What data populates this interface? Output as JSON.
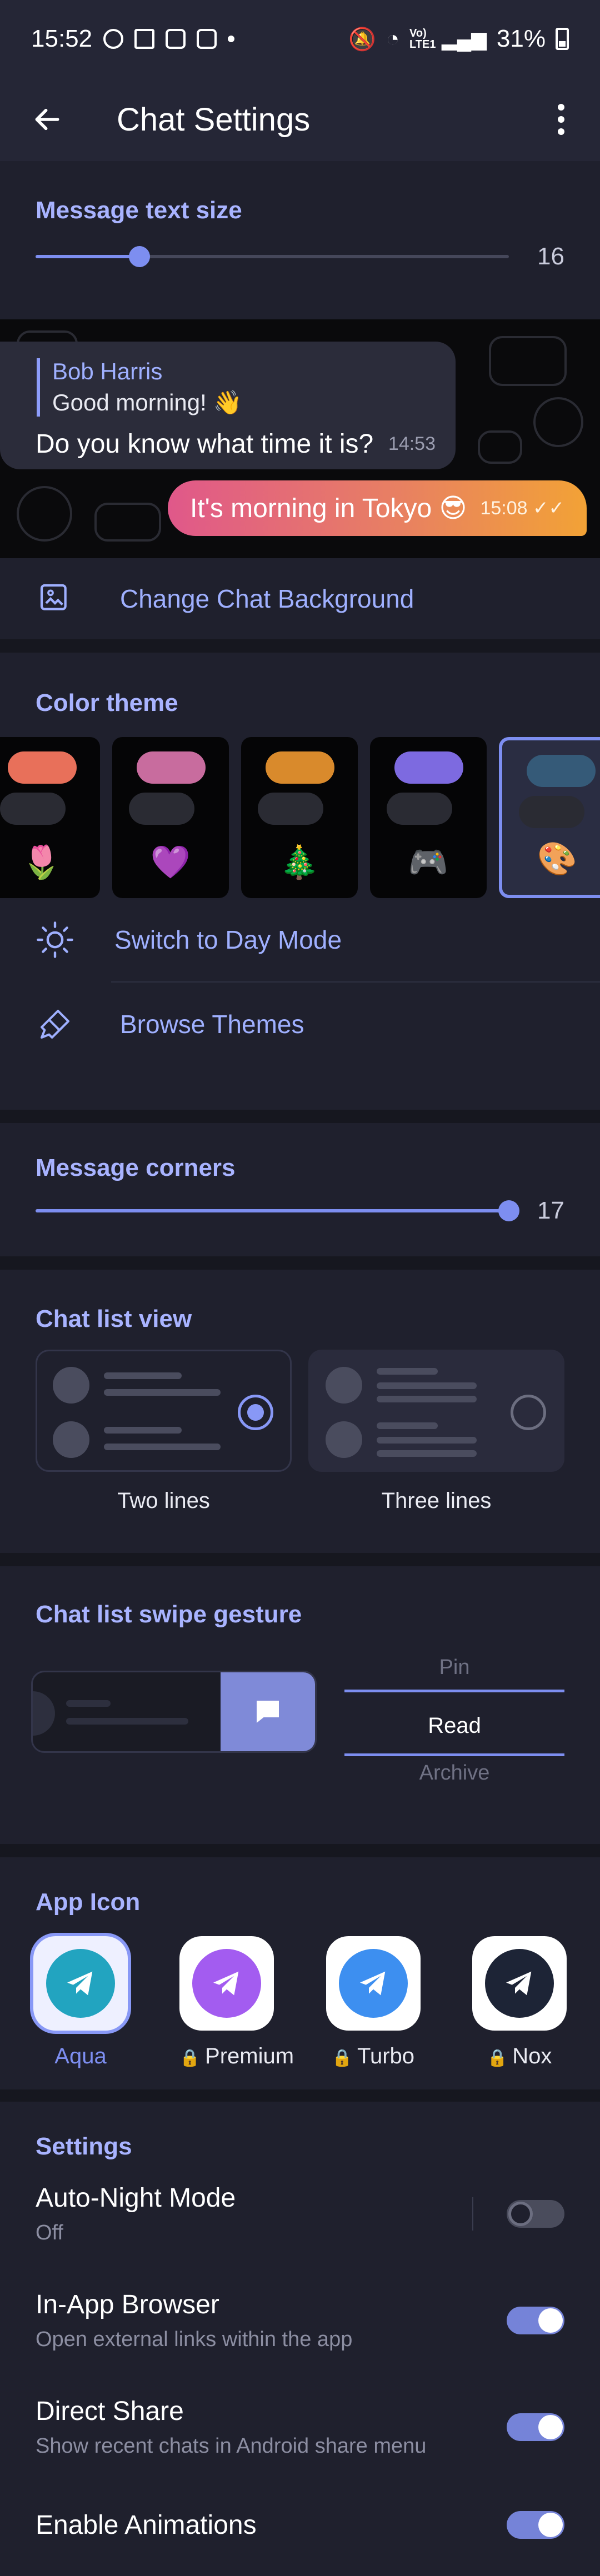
{
  "status_bar": {
    "time": "15:52",
    "battery": "31%",
    "signal_label": "Vo) LTE1"
  },
  "app_bar": {
    "title": "Chat Settings",
    "back_icon": "arrow-left",
    "menu_icon": "more-vertical"
  },
  "text_size": {
    "title": "Message text size",
    "value": "16",
    "fraction": 0.22
  },
  "preview": {
    "reply_name": "Bob Harris",
    "reply_text": "Good morning! 👋",
    "incoming_text": "Do you know what time it is?",
    "incoming_time": "14:53",
    "outgoing_text": "It's morning in Tokyo 😎",
    "outgoing_time": "15:08"
  },
  "change_background": {
    "label": "Change Chat Background",
    "icon": "image-icon"
  },
  "color_theme": {
    "title": "Color theme",
    "themes": [
      {
        "emoji": "🌷",
        "pill_color": "#e8705a"
      },
      {
        "emoji": "💜",
        "pill_color": "#c86c9e"
      },
      {
        "emoji": "🎄",
        "pill_color": "#d98a2c"
      },
      {
        "emoji": "🎮",
        "pill_color": "#7d6ae0"
      },
      {
        "emoji": "🎨",
        "pill_color": "#355a78",
        "selected": true
      }
    ],
    "day_mode_label": "Switch to Day Mode",
    "browse_label": "Browse Themes"
  },
  "corners": {
    "title": "Message corners",
    "value": "17",
    "fraction": 1.0
  },
  "chat_list_view": {
    "title": "Chat list view",
    "options": [
      "Two lines",
      "Three lines"
    ],
    "selected_index": 0
  },
  "swipe": {
    "title": "Chat list swipe gesture",
    "options": [
      "Pin",
      "Read",
      "Archive"
    ],
    "selected": "Read"
  },
  "app_icon": {
    "title": "App Icon",
    "icons": [
      {
        "name": "Aqua",
        "locked": false,
        "selected": true,
        "color": "#22a4c0"
      },
      {
        "name": "Premium",
        "locked": true,
        "selected": false,
        "color": "#a35cf0"
      },
      {
        "name": "Turbo",
        "locked": true,
        "selected": false,
        "color": "#3d8ff0"
      },
      {
        "name": "Nox",
        "locked": true,
        "selected": false,
        "color": "#1d2436"
      }
    ]
  },
  "settings": {
    "title": "Settings",
    "items": [
      {
        "title": "Auto-Night Mode",
        "subtitle": "Off",
        "on": false
      },
      {
        "title": "In-App Browser",
        "subtitle": "Open external links within the app",
        "on": true
      },
      {
        "title": "Direct Share",
        "subtitle": "Show recent chats in Android share menu",
        "on": true
      },
      {
        "title": "Enable Animations",
        "subtitle": "",
        "on": true
      }
    ]
  },
  "colors": {
    "accent": "#7d8ef0",
    "accent_text": "#a8b3ff",
    "background": "#1f202d"
  }
}
